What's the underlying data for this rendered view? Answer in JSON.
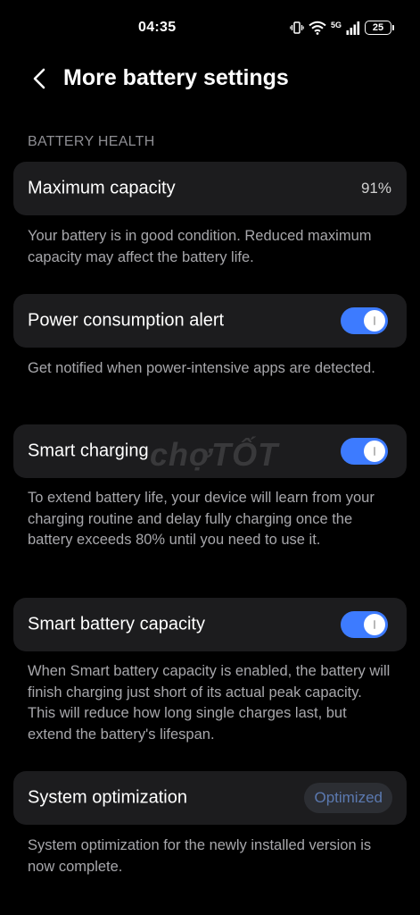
{
  "status_bar": {
    "time": "04:35",
    "network": "5G",
    "battery_level": "25"
  },
  "header": {
    "title": "More battery settings"
  },
  "battery_health": {
    "section_label": "BATTERY HEALTH",
    "max_capacity_label": "Maximum capacity",
    "max_capacity_value": "91%",
    "max_capacity_desc": "Your battery is in good condition. Reduced maximum capacity may affect the battery life."
  },
  "power_alert": {
    "label": "Power consumption alert",
    "enabled": true,
    "desc": "Get notified when power-intensive apps are detected."
  },
  "smart_charging": {
    "label": "Smart charging",
    "enabled": true,
    "desc": "To extend battery life, your device will learn from your charging routine and delay fully charging once the battery exceeds 80% until you need to use it."
  },
  "smart_battery_capacity": {
    "label": "Smart battery capacity",
    "enabled": true,
    "desc": "When Smart battery capacity is enabled, the battery will finish charging just short of its actual peak capacity. This will reduce how long single charges last, but extend the battery's lifespan."
  },
  "system_optimization": {
    "label": "System optimization",
    "status": "Optimized",
    "desc": "System optimization for the newly installed version is now complete."
  },
  "watermark": "chợTỐT",
  "colors": {
    "accent": "#3d7bff",
    "card_bg": "#1c1c1e",
    "secondary_text": "#a7a7ab"
  }
}
